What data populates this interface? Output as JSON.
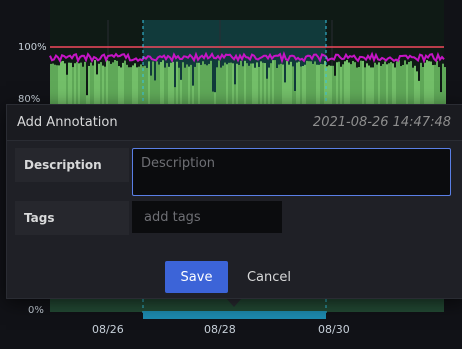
{
  "chart": {
    "y_ticks": [
      "100%",
      "80%",
      "0%"
    ],
    "x_ticks": [
      "08/26",
      "08/28",
      "08/30"
    ]
  },
  "colors": {
    "threshold_line": "#f2495c",
    "upper_series": "#c515c5",
    "lower_series": "#73bf69",
    "selection": "#14626a",
    "accent": "#3c64d8"
  },
  "modal": {
    "title": "Add Annotation",
    "timestamp": "2021-08-26 14:47:48",
    "description_label": "Description",
    "description_placeholder": "Description",
    "description_value": "",
    "tags_label": "Tags",
    "tags_placeholder": "add tags",
    "save_label": "Save",
    "cancel_label": "Cancel"
  }
}
